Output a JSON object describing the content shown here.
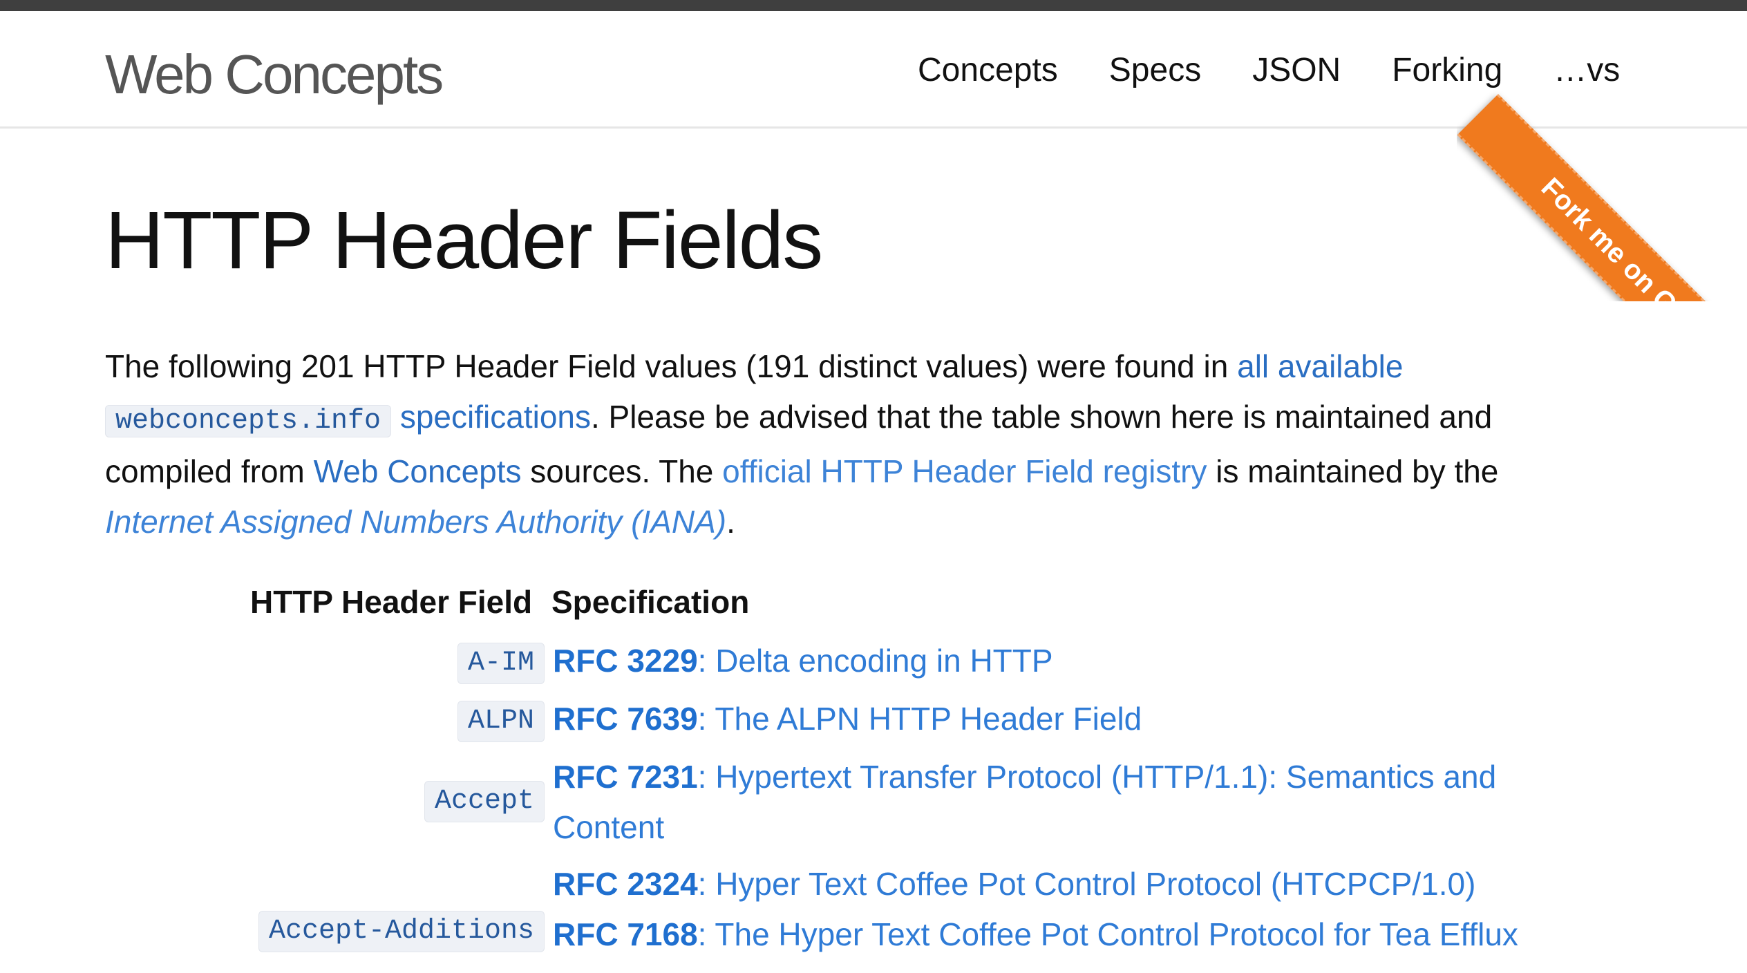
{
  "header": {
    "brand": "Web Concepts",
    "nav": [
      "Concepts",
      "Specs",
      "JSON",
      "Forking",
      "…vs"
    ],
    "ribbon": "Fork me on GitHub"
  },
  "page": {
    "title": "HTTP Header Fields",
    "intro": {
      "t1": "The following 201 HTTP Header Field values (191 distinct values) were found in ",
      "link_all": "all available",
      "code": "webconcepts.info",
      "link_specs": "specifications",
      "t2": ". Please be advised that the table shown here is maintained and compiled from ",
      "link_wc": "Web Concepts",
      "t3": " sources. The ",
      "link_registry": "official HTTP Header Field registry",
      "t4": " is maintained by the ",
      "link_iana": "Internet Assigned Numbers Authority (IANA)",
      "t5": "."
    }
  },
  "table": {
    "head_field": "HTTP Header Field",
    "head_spec": "Specification",
    "rows": [
      {
        "field": "A-IM",
        "rfc": "RFC 3229",
        "title": ": Delta encoding in HTTP"
      },
      {
        "field": "ALPN",
        "rfc": "RFC 7639",
        "title": ": The ALPN HTTP Header Field"
      },
      {
        "field": "Accept",
        "rfc": "RFC 7231",
        "title": ": Hypertext Transfer Protocol (HTTP/1.1): Semantics and",
        "title2": "Content"
      },
      {
        "field": "",
        "rfc": "RFC 2324",
        "title": ": Hyper Text Coffee Pot Control Protocol (HTCPCP/1.0)"
      },
      {
        "field": "Accept-Additions",
        "rfc": "RFC 7168",
        "title": ": The Hyper Text Coffee Pot Control Protocol for Tea Efflux"
      }
    ]
  }
}
